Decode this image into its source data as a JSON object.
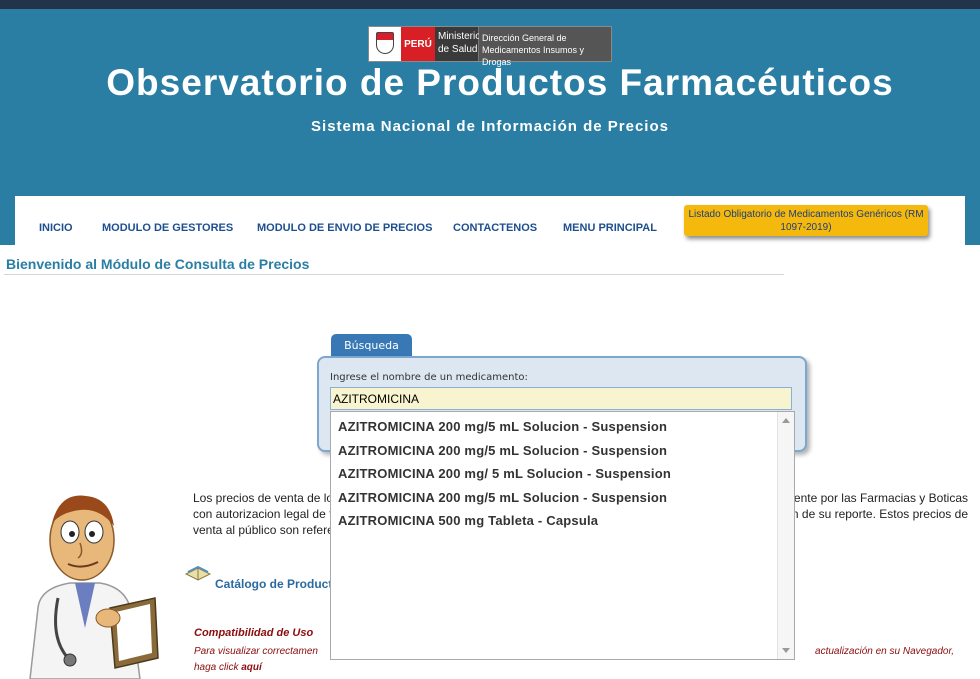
{
  "logo": {
    "country": "PERÚ",
    "ministry": "Ministerio de Salud",
    "directorate": "Dirección General de Medicamentos Insumos y Drogas"
  },
  "header": {
    "title": "Observatorio de Productos Farmacéuticos",
    "subtitle": "Sistema Nacional de Información de Precios"
  },
  "nav": {
    "items": [
      "INICIO",
      "MODULO DE GESTORES",
      "MODULO DE ENVIO DE PRECIOS",
      "CONTACTENOS",
      "MENU PRINCIPAL"
    ],
    "generic_button": "Listado Obligatorio de Medicamentos Genéricos (RM 1097-2019)"
  },
  "welcome": "Bienvenido al Módulo de Consulta de Precios",
  "search": {
    "tab_label": "Búsqueda",
    "field_label": "Ingrese el nombre de un medicamento:",
    "value": "AZITROMICINA"
  },
  "suggestions": [
    "AZITROMICINA 200 mg/5 mL Solucion - Suspension",
    "AZITROMICINA 200 mg/5 mL Solucion - Suspension",
    "AZITROMICINA 200 mg/ 5 mL Solucion - Suspension",
    "AZITROMICINA 200 mg/5 mL Solucion - Suspension",
    "AZITROMICINA 500 mg Tableta - Capsula"
  ],
  "info": {
    "line1_left": "Los precios de venta de lo",
    "line1_right": "ente por las Farmacias y Boticas",
    "line2_left": "con autorizacion legal de f",
    "line2_right": "n de su reporte. Estos precios de",
    "line3_left": "venta al público son refere"
  },
  "catalog_link": "Catálogo de Producto",
  "compat": {
    "title": "Compatibilidad de Uso",
    "line1_left": "Para visualizar correctamen",
    "line1_right": "actualización en su Navegador,",
    "line2_prefix": "haga click ",
    "line2_link": "aquí"
  },
  "colors": {
    "header_bg": "#2a7ea4",
    "nav_text": "#1d4f8f",
    "button_bg": "#f5b80d",
    "compat_text": "#8b0d0d"
  }
}
